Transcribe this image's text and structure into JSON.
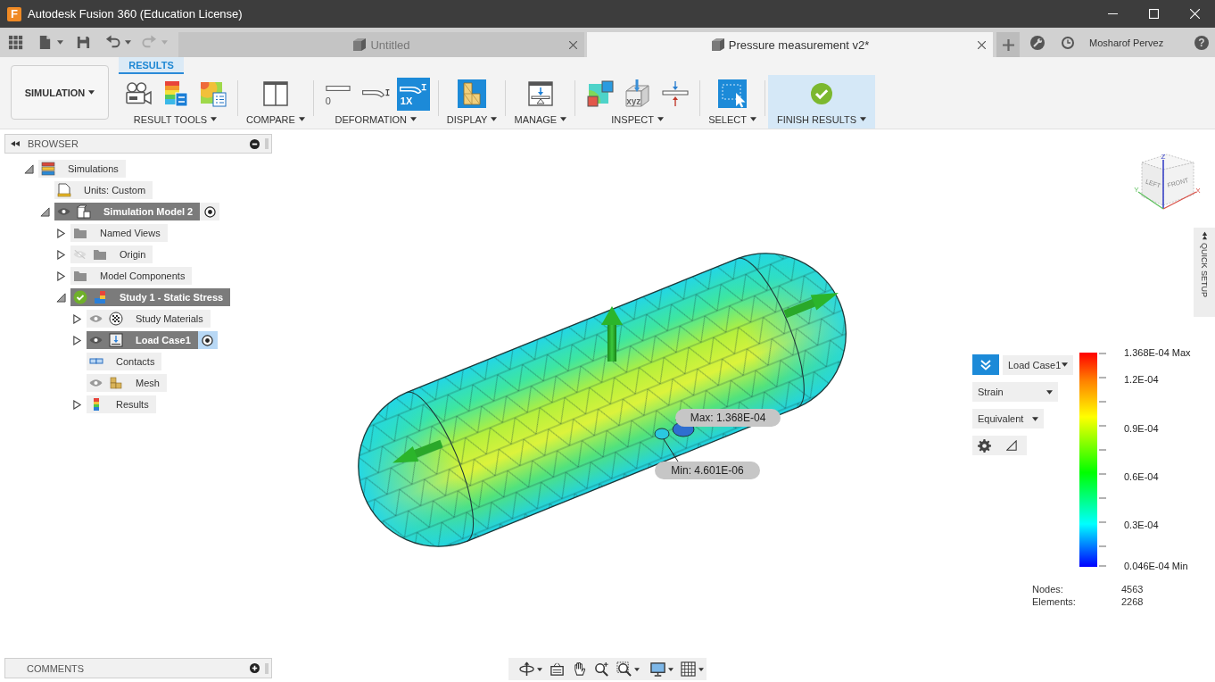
{
  "window": {
    "title": "Autodesk Fusion 360 (Education License)",
    "logo_text": "F"
  },
  "quick_access": [
    {
      "kind": "apps",
      "disabled": false
    },
    {
      "kind": "file",
      "disabled": false
    },
    {
      "kind": "save",
      "disabled": false
    },
    {
      "kind": "undo",
      "disabled": false
    },
    {
      "kind": "redo",
      "disabled": true
    }
  ],
  "tabs": [
    {
      "label": "Untitled",
      "selected": false
    },
    {
      "label": "Pressure measurement v2*",
      "selected": true
    }
  ],
  "user": {
    "name": "Mosharof Pervez",
    "help": "?"
  },
  "toolbar": {
    "workspace": "SIMULATION",
    "tab": "RESULTS",
    "groups": [
      {
        "label": "RESULT TOOLS",
        "highlighted": false,
        "tools": [
          {
            "kind": "animate",
            "selected": false
          },
          {
            "kind": "legend",
            "selected": false
          },
          {
            "kind": "contour",
            "selected": false
          }
        ]
      },
      {
        "label": "COMPARE",
        "highlighted": false,
        "tools": [
          {
            "kind": "compare",
            "selected": false
          }
        ]
      },
      {
        "label": "DEFORMATION",
        "highlighted": false,
        "tools": [
          {
            "kind": "deform-none",
            "text": "0",
            "selected": false
          },
          {
            "kind": "deform-adjusted",
            "selected": false
          },
          {
            "kind": "deform-actual",
            "text": "1X",
            "selected": true
          }
        ]
      },
      {
        "label": "DISPLAY",
        "highlighted": false,
        "tools": [
          {
            "kind": "display",
            "selected": false
          }
        ]
      },
      {
        "label": "MANAGE",
        "highlighted": false,
        "tools": [
          {
            "kind": "manage",
            "selected": false
          }
        ]
      },
      {
        "label": "INSPECT",
        "highlighted": false,
        "tools": [
          {
            "kind": "inspect-surface",
            "selected": false
          },
          {
            "kind": "probe",
            "text": "xyz",
            "selected": false
          },
          {
            "kind": "section",
            "selected": false
          }
        ]
      },
      {
        "label": "SELECT",
        "highlighted": false,
        "tools": [
          {
            "kind": "select",
            "selected": false
          }
        ]
      },
      {
        "label": "FINISH RESULTS",
        "highlighted": true,
        "tools": [
          {
            "kind": "finish",
            "selected": false
          }
        ]
      }
    ]
  },
  "browser": {
    "title": "BROWSER",
    "tree": [
      {
        "label": "Simulations",
        "kind": "simulations",
        "expanded": true,
        "active": false,
        "children": [
          {
            "label": "Units: Custom",
            "kind": "units",
            "active": false
          },
          {
            "label": "Simulation Model 2",
            "kind": "model",
            "expanded": true,
            "visible": true,
            "active": true,
            "radio": {
              "on": true,
              "focused": false
            },
            "children": [
              {
                "label": "Named Views",
                "kind": "folder",
                "expanded": false,
                "active": false
              },
              {
                "label": "Origin",
                "kind": "folder",
                "expanded": false,
                "visible": false,
                "active": false
              },
              {
                "label": "Model Components",
                "kind": "folder",
                "expanded": false,
                "active": false
              },
              {
                "label": "Study 1 - Static Stress",
                "kind": "study",
                "expanded": true,
                "active": true,
                "children": [
                  {
                    "label": "Study Materials",
                    "kind": "materials",
                    "expanded": false,
                    "visible": true,
                    "active": false
                  },
                  {
                    "label": "Load Case1",
                    "kind": "load-case",
                    "expanded": false,
                    "visible": true,
                    "active": true,
                    "radio": {
                      "on": true,
                      "focused": true
                    }
                  },
                  {
                    "label": "Contacts",
                    "kind": "contacts",
                    "active": false
                  },
                  {
                    "label": "Mesh",
                    "kind": "mesh",
                    "visible": true,
                    "active": false
                  },
                  {
                    "label": "Results",
                    "kind": "results",
                    "expanded": false,
                    "active": false
                  }
                ]
              }
            ]
          }
        ]
      }
    ]
  },
  "viewport": {
    "probes": [
      {
        "label": "Max: 1.368E-04"
      },
      {
        "label": "Min: 4.601E-06"
      }
    ],
    "view_cube": {
      "faces": [
        "LEFT",
        "FRONT"
      ],
      "axes": [
        "X",
        "Y",
        "Z"
      ]
    }
  },
  "quick_setup": {
    "label": "QUICK SETUP"
  },
  "legend": {
    "load_case": "Load Case1",
    "result": "Strain",
    "component": "Equivalent",
    "scale": [
      "1.368E-04 Max",
      "1.2E-04",
      "0.9E-04",
      "0.6E-04",
      "0.3E-04",
      "0.046E-04 Min"
    ],
    "stats": [
      {
        "label": "Nodes:",
        "value": "4563"
      },
      {
        "label": "Elements:",
        "value": "2268"
      }
    ]
  },
  "comments": {
    "title": "COMMENTS"
  }
}
